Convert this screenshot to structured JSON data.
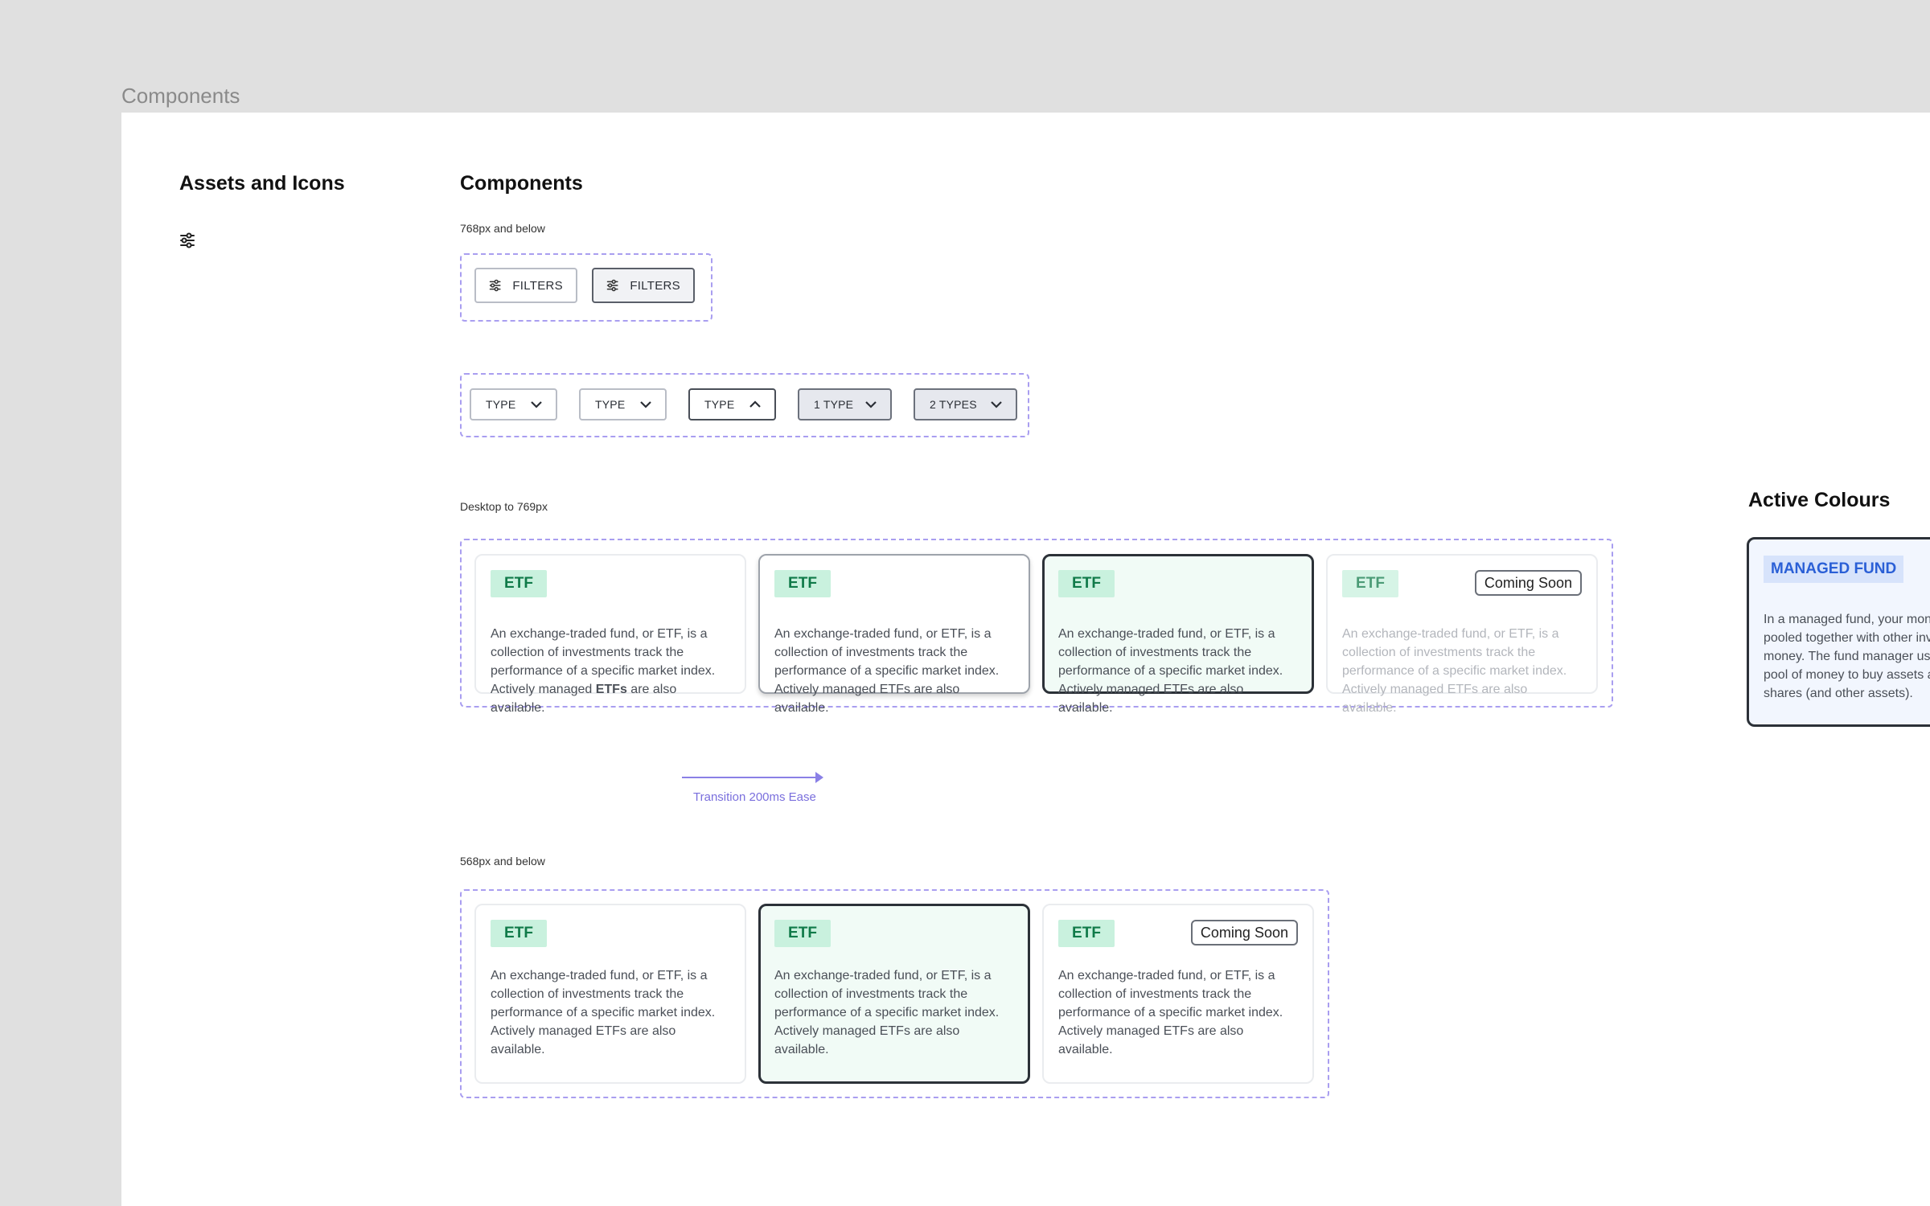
{
  "frame": {
    "label": "Components"
  },
  "assets": {
    "title": "Assets and Icons",
    "icon": "sliders-icon"
  },
  "components": {
    "title": "Components",
    "mobile_caption": "768px and below",
    "filters": [
      {
        "label": "FILTERS",
        "state": "default"
      },
      {
        "label": "FILTERS",
        "state": "active"
      }
    ],
    "type_dropdowns": [
      {
        "label": "TYPE",
        "chevron": "down",
        "state": "default"
      },
      {
        "label": "TYPE",
        "chevron": "down",
        "state": "hover"
      },
      {
        "label": "TYPE",
        "chevron": "up",
        "state": "open"
      },
      {
        "label": "1 TYPE",
        "chevron": "down",
        "state": "selected"
      },
      {
        "label": "2 TYPES",
        "chevron": "down",
        "state": "selected"
      }
    ],
    "desktop_caption": "Desktop to 769px",
    "small_caption": "568px and below",
    "transition_label": "Transition 200ms Ease"
  },
  "cards_desktop": [
    {
      "badge": "ETF",
      "text_pre": "An exchange-traded fund, or ETF, is a collection of investments track the performance of a specific market index. Actively managed ",
      "text_bold": "ETFs",
      "text_post": " are also available.",
      "state": "default"
    },
    {
      "badge": "ETF",
      "text": "An exchange-traded fund, or ETF, is a collection of investments track the performance of a specific market index. Actively managed ETFs are also available.",
      "state": "hover"
    },
    {
      "badge": "ETF",
      "text": "An exchange-traded fund, or ETF, is a collection of investments track the performance of a specific market index. Actively managed ETFs are also available.",
      "state": "active"
    },
    {
      "badge": "ETF",
      "text": "An exchange-traded fund, or ETF, is a collection of investments track the performance of a specific market index. Actively managed ETFs are also available.",
      "tag": "Coming Soon",
      "state": "disabled"
    }
  ],
  "cards_small": [
    {
      "badge": "ETF",
      "text": "An exchange-traded fund, or ETF, is a collection of investments track the performance of a specific market index. Actively managed ETFs are also available.",
      "state": "default"
    },
    {
      "badge": "ETF",
      "text": "An exchange-traded fund, or ETF, is a collection of investments track the performance of a specific market index. Actively managed ETFs are also available.",
      "state": "active"
    },
    {
      "badge": "ETF",
      "text": "An exchange-traded fund, or ETF, is a collection of investments track the performance of a specific market index. Actively managed ETFs are also available.",
      "tag": "Coming Soon",
      "state": "default"
    }
  ],
  "active_colours": {
    "title": "Active Colours",
    "badge": "MANAGED FUND",
    "text": "In a managed fund, your money is pooled together with other investors' money. The fund manager uses this pool of money to buy assets and shares (and other assets)."
  },
  "colors": {
    "accent_dashed": "#a99ef0",
    "etf_badge_bg": "#c9f1de",
    "etf_badge_text": "#107a49",
    "active_card_bg": "#f1fbf6",
    "managed_fund_badge_bg": "#d7e3fb",
    "managed_fund_badge_text": "#2a5fd6"
  }
}
